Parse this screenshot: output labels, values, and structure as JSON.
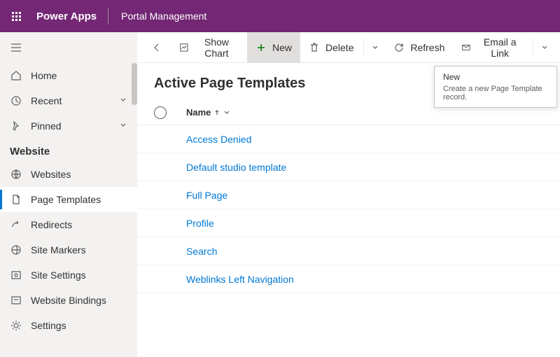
{
  "header": {
    "app_name": "Power Apps",
    "env_name": "Portal Management"
  },
  "nav": {
    "home": "Home",
    "recent": "Recent",
    "pinned": "Pinned",
    "section": "Website",
    "items": [
      "Websites",
      "Page Templates",
      "Redirects",
      "Site Markers",
      "Site Settings",
      "Website Bindings",
      "Settings"
    ]
  },
  "commands": {
    "show_chart": "Show Chart",
    "new": "New",
    "delete": "Delete",
    "refresh": "Refresh",
    "email_link": "Email a Link"
  },
  "view": {
    "title": "Active Page Templates",
    "column_name": "Name"
  },
  "rows": [
    "Access Denied",
    "Default studio template",
    "Full Page",
    "Profile",
    "Search",
    "Weblinks Left Navigation"
  ],
  "tooltip": {
    "title": "New",
    "body": "Create a new Page Template record."
  }
}
